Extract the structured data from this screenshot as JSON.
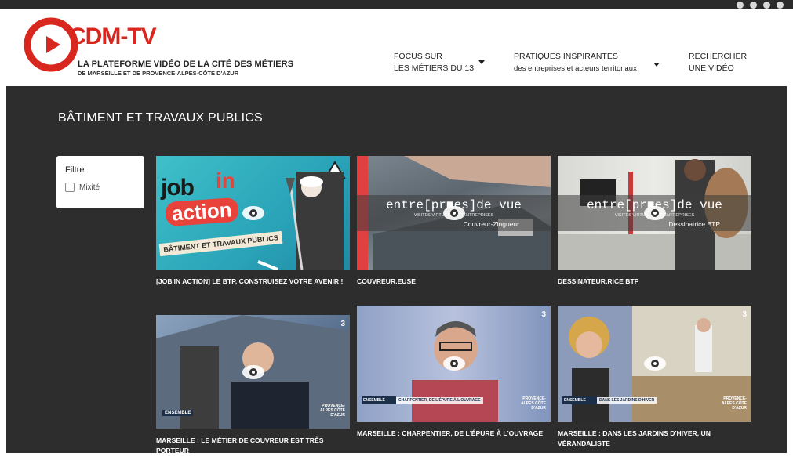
{
  "brand": {
    "logo_text": "CDM-TV",
    "tagline_line1": "LA PLATEFORME VIDÉO DE LA CITÉ DES MÉTIERS",
    "tagline_line2": "DE MARSEILLE ET DE PROVENCE-ALPES-CÔTE D'AZUR",
    "red": "#d7271f"
  },
  "nav": [
    {
      "line1": "FOCUS SUR",
      "line2": "LES MÉTIERS DU 13",
      "icon": "caret-down-icon"
    },
    {
      "line1": "PRATIQUES INSPIRANTES",
      "line2": "des entreprises et acteurs territoriaux",
      "icon": "caret-down-icon"
    },
    {
      "line1": "RECHERCHER",
      "line2": "UNE VIDÉO"
    }
  ],
  "section": {
    "title": "BÂTIMENT ET TRAVAUX PUBLICS"
  },
  "filter": {
    "title": "Filtre",
    "option": "Mixité",
    "checked": false
  },
  "videos": [
    {
      "title": "[JOB'IN ACTION] LE BTP, CONSTRUISEZ VOTRE AVENIR !",
      "thumb": {
        "line1": "job",
        "line2": "in",
        "line3": "action",
        "banner": "BÂTIMENT ET TRAVAUX PUBLICS"
      }
    },
    {
      "title": "COUVREUR.EUSE",
      "thumb": {
        "main": "entre[pr■es]de vue",
        "sub": "VISITES VIRTUELLES D'ENTREPRISES",
        "job": "Couvreur-Zingueur"
      }
    },
    {
      "title": "DESSINATEUR.RICE BTP",
      "thumb": {
        "main": "entre[pr■es]de vue",
        "sub": "VISITES VIRTUELLES D'ENTREPRISES",
        "job": "Dessinatrice BTP"
      }
    },
    {
      "title": "MARSEILLE : LE MÉTIER DE COUVREUR EST TRÈS PORTEUR",
      "thumb": {
        "channel": "3",
        "tag1": "ENSEMBLE",
        "tag2": "PROVENCE-ALPES CÔTE D'AZUR"
      }
    },
    {
      "title": "MARSEILLE : CHARPENTIER, DE L'ÉPURE À L'OUVRAGE",
      "thumb": {
        "channel": "3",
        "tag1": "ENSEMBLE",
        "lower": "CHARPENTIER, DE L'ÉPURE À L'OUVRAGE",
        "tag2": "PROVENCE-ALPES CÔTE D'AZUR"
      }
    },
    {
      "title": "MARSEILLE : DANS LES JARDINS D'HIVER, UN VÉRANDALISTE",
      "thumb": {
        "channel": "3",
        "tag1": "ENSEMBLE",
        "lower": "DANS LES JARDINS D'HIVER",
        "tag2": "PROVENCE-ALPES CÔTE D'AZUR"
      }
    }
  ]
}
